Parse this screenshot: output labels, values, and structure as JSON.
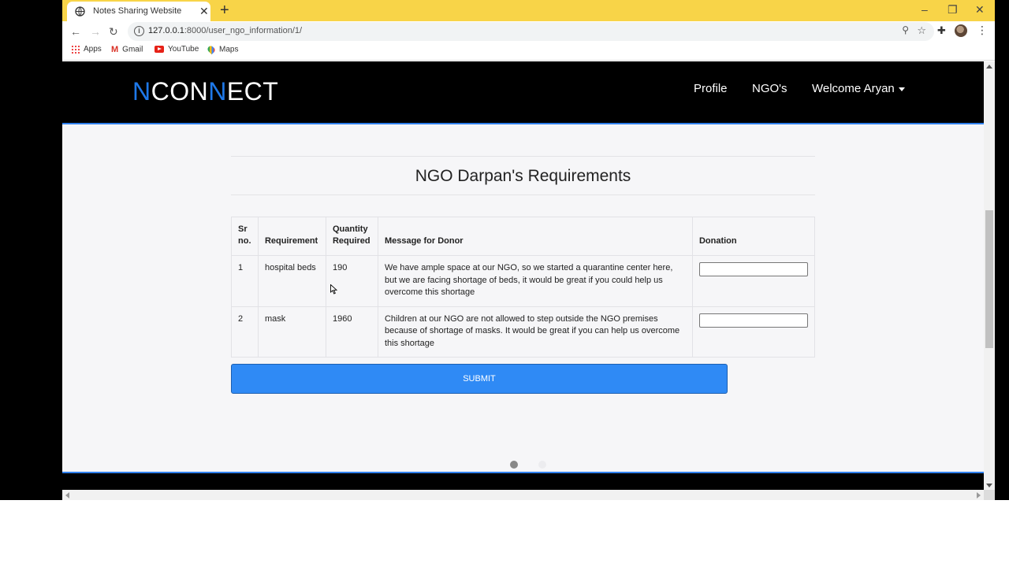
{
  "browser": {
    "tab_title": "Notes Sharing Website",
    "tab_close": "✕",
    "new_tab": "+",
    "url_host": "127.0.0.1",
    "url_rest": ":8000/user_ngo_information/1/",
    "bookmarks": [
      {
        "label": "Apps",
        "icon": "apps-icon"
      },
      {
        "label": "Gmail",
        "icon": "gmail-icon"
      },
      {
        "label": "YouTube",
        "icon": "youtube-icon"
      },
      {
        "label": "Maps",
        "icon": "maps-icon"
      }
    ],
    "window_controls": {
      "minimize": "–",
      "restore": "❐",
      "close": "✕"
    }
  },
  "navbar": {
    "brand_parts": [
      "N",
      "CON",
      "N",
      "ECT"
    ],
    "links": {
      "profile": "Profile",
      "ngos": "NGO's",
      "welcome": "Welcome Aryan"
    }
  },
  "main": {
    "heading": "NGO Darpan's Requirements",
    "table": {
      "headers": {
        "sr_1": "Sr",
        "sr_2": "no.",
        "requirement": "Requirement",
        "qty_1": "Quantity",
        "qty_2": "Required",
        "message": "Message for Donor",
        "donation": "Donation"
      },
      "rows": [
        {
          "sr": "1",
          "requirement": "hospital beds",
          "quantity": "190",
          "message": "We have ample space at our NGO, so we started a quarantine center here, but we are facing shortage of beds, it would be great if you could help us overcome this shortage",
          "donation": ""
        },
        {
          "sr": "2",
          "requirement": "mask",
          "quantity": "1960",
          "message": "Children at our NGO are not allowed to step outside the NGO premises because of shortage of masks. It would be great if you can help us overcome this shortage",
          "donation": ""
        }
      ]
    },
    "submit_label": "SUBMIT"
  },
  "colors": {
    "brand_blue": "#1e78e8",
    "submit_blue": "#2f8af5",
    "tab_strip": "#f8d448",
    "navbar": "#000000"
  }
}
